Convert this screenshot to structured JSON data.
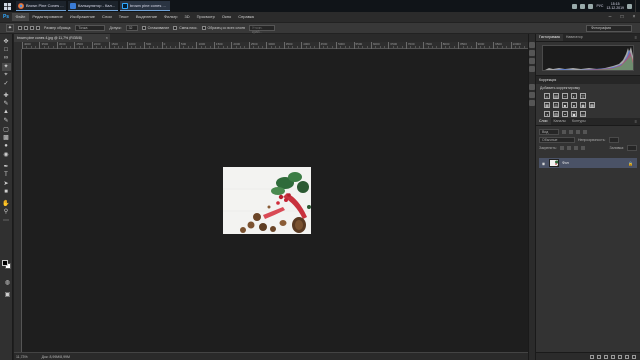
{
  "taskbar": {
    "tasks": [
      {
        "label": "Brown Pine Cones ...",
        "icon": "chrome-icon",
        "color": "#e8a91c"
      },
      {
        "label": "Калькулятор - Кал...",
        "icon": "calculator-icon",
        "color": "#3a7bd5"
      },
      {
        "label": "brown pine cones ...",
        "icon": "photoshop-icon",
        "color": "#31a8ff"
      }
    ],
    "lang": "РУС",
    "time": "15:15",
    "date": "13.12.2019"
  },
  "menubar": {
    "app_icon": "Ps",
    "items": [
      "Файл",
      "Редактирование",
      "Изображение",
      "Слои",
      "Текст",
      "Выделение",
      "Фильтр",
      "3D",
      "Просмотр",
      "Окно",
      "Справка"
    ]
  },
  "optbar": {
    "sample_size_label": "Размер образца:",
    "sample_size_value": "Точка",
    "tolerance_label": "Допуск:",
    "tolerance_value": "32",
    "antialias_label": "Сглаживание",
    "contiguous_label": "Смеж.пикс.",
    "all_layers_label": "Образец со всех слоев",
    "refine_label": "Уточн. край...",
    "workspace": "Фотография"
  },
  "document": {
    "tab_label": "brown pine cones 4.jpg @ 11,7% (RGB/8)",
    "zoom": "11,73%",
    "doc_size": "Док: 8,99M/8,99M"
  },
  "rulers": {
    "top": [
      "4000",
      "3500",
      "3000",
      "2500",
      "2000",
      "1500",
      "1000",
      "500",
      "0",
      "500",
      "1000",
      "1500",
      "2000",
      "2500",
      "3000",
      "3500",
      "4000",
      "4500",
      "5000",
      "5500",
      "6000",
      "6500",
      "7000",
      "7500",
      "8000",
      "8500",
      "9000",
      "9500",
      "10000"
    ]
  },
  "panels": {
    "histogram_tab": "Гистограмма",
    "navigator_tab": "Навигатор",
    "correction_tab": "Коррекция",
    "adjustments_title": "Добавить корректировку",
    "layers_tab": "Слои",
    "channels_tab": "Каналы",
    "contours_tab": "Контуры",
    "kind_label": "Вид",
    "blend_mode": "Обычные",
    "opacity_label": "Непрозрачность:",
    "lock_label": "Закрепить:",
    "fill_label": "Заливка:",
    "layer_name": "Фон"
  },
  "colors": {
    "accent": "#31a8ff",
    "layer_selected": "#4a5266",
    "canvas_bg": "#1e1e1e"
  }
}
